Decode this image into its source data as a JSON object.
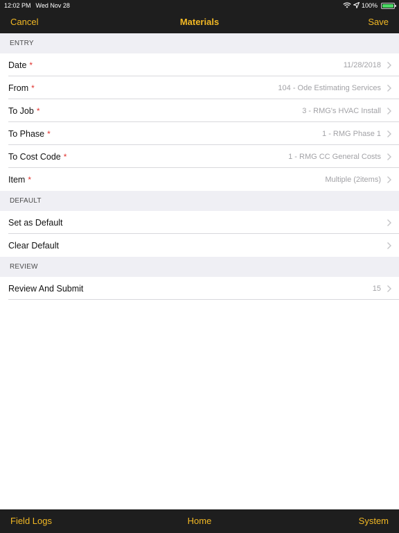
{
  "status_bar": {
    "time": "12:02 PM",
    "date": "Wed Nov 28",
    "battery": "100%",
    "icons": [
      "wifi-icon",
      "location-arrow-icon",
      "battery-charging-icon"
    ]
  },
  "nav": {
    "cancel_label": "Cancel",
    "title": "Materials",
    "save_label": "Save"
  },
  "sections": {
    "entry": {
      "header": "ENTRY",
      "rows": [
        {
          "label": "Date",
          "value": "11/28/2018"
        },
        {
          "label": "From",
          "value": "104 - Ode Estimating Services"
        },
        {
          "label": "To Job",
          "value": "3 - RMG's HVAC Install"
        },
        {
          "label": "To Phase",
          "value": "1 - RMG Phase 1"
        },
        {
          "label": "To Cost Code",
          "value": "1 - RMG CC General Costs"
        },
        {
          "label": "Item",
          "value": "Multiple (2items)"
        }
      ],
      "required_marker": "*"
    },
    "default": {
      "header": "DEFAULT",
      "rows": [
        {
          "label": "Set as Default"
        },
        {
          "label": "Clear Default"
        }
      ]
    },
    "review": {
      "header": "REVIEW",
      "rows": [
        {
          "label": "Review And Submit",
          "value": "15"
        }
      ]
    }
  },
  "tab_bar": {
    "field_logs": "Field Logs",
    "home": "Home",
    "system": "System"
  },
  "colors": {
    "accent": "#f2b824",
    "bar_background": "#1e1e1e",
    "section_background": "#efeff4",
    "required": "#e0322e",
    "value_text": "#a2a2a6"
  }
}
